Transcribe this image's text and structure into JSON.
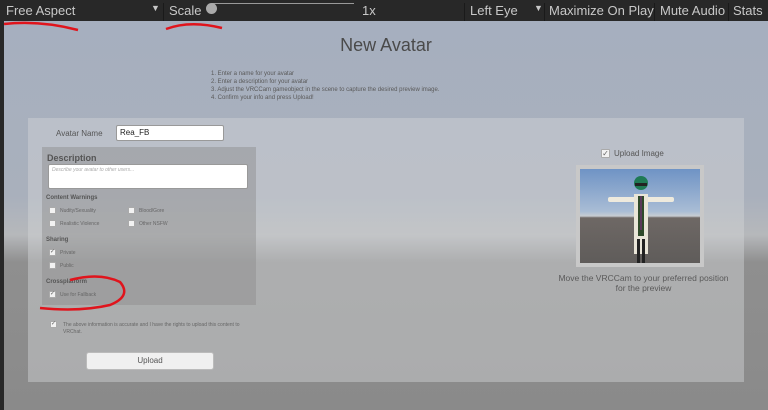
{
  "toolbar": {
    "aspect": "Free Aspect",
    "scale_label": "Scale",
    "scale_value": "1x",
    "scale_fraction": 0.0,
    "eye": "Left Eye",
    "maximize": "Maximize On Play",
    "mute": "Mute Audio",
    "stats": "Stats"
  },
  "form": {
    "title": "New Avatar",
    "steps": [
      "1. Enter a name for your avatar",
      "2. Enter a description for your avatar",
      "3. Adjust the VRCCam gameobject in the scene to capture the desired preview image.",
      "4. Confirm your info and press Upload!"
    ],
    "name_label": "Avatar Name",
    "name_value": "Rea_FB",
    "description_heading": "Description",
    "description_placeholder": "Describe your avatar to other users...",
    "warnings_heading": "Content Warnings",
    "warnings": [
      {
        "label": "Nudity/Sexuality",
        "checked": false
      },
      {
        "label": "Blood/Gore",
        "checked": false
      },
      {
        "label": "Realistic Violence",
        "checked": false
      },
      {
        "label": "Other NSFW",
        "checked": false
      }
    ],
    "sharing_heading": "Sharing",
    "sharing": [
      {
        "label": "Private",
        "checked": true
      },
      {
        "label": "Public",
        "checked": false
      }
    ],
    "crossplatform_heading": "Crossplatform",
    "fallback": {
      "label": "Use for Fallback",
      "checked": true
    },
    "terms": {
      "label": "The above information is accurate and I have the rights to upload this content to VRChat.",
      "checked": true
    },
    "upload": "Upload",
    "upload_image": {
      "label": "Upload Image",
      "checked": true
    },
    "caption": "Move the VRCCam to your preferred position for the preview"
  },
  "annotation_color": "#e0141c"
}
